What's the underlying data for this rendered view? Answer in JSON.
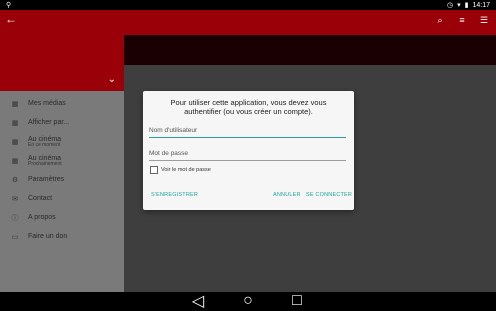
{
  "status": {
    "left_icon": "usb-icon",
    "time": "14:17"
  },
  "appbar": {
    "back_icon": "arrow-back-icon",
    "icons": [
      "search-icon",
      "filter-icon",
      "sort-icon"
    ]
  },
  "drawer": {
    "items": [
      {
        "label": "Mes médias",
        "sub": "",
        "icon": "film-icon"
      },
      {
        "label": "Afficher par...",
        "sub": "",
        "icon": "film-icon"
      },
      {
        "label": "Au cinéma",
        "sub": "En ce moment",
        "icon": "film-icon"
      },
      {
        "label": "Au cinéma",
        "sub": "Prochainement",
        "icon": "film-icon"
      },
      {
        "label": "Paramètres",
        "sub": "",
        "icon": "gear-icon"
      },
      {
        "label": "Contact",
        "sub": "",
        "icon": "mail-icon"
      },
      {
        "label": "A propos",
        "sub": "",
        "icon": "info-icon"
      },
      {
        "label": "Faire un don",
        "sub": "",
        "icon": "wallet-icon"
      }
    ]
  },
  "dialog": {
    "message": "Pour utiliser cette application, vous devez vous authentifier (ou vous créer un compte).",
    "username_placeholder": "Nom d'utilisateur",
    "password_placeholder": "Mot de passe",
    "show_password": "Voir le mot de passe",
    "register": "S'ENREGISTRER",
    "cancel": "ANNULER",
    "login": "SE CONNECTER"
  },
  "navbar": {
    "icons": [
      "back-nav-icon",
      "home-nav-icon",
      "recents-nav-icon"
    ]
  },
  "colors": {
    "accent": "#9a0007",
    "teal": "#1ea59a"
  }
}
